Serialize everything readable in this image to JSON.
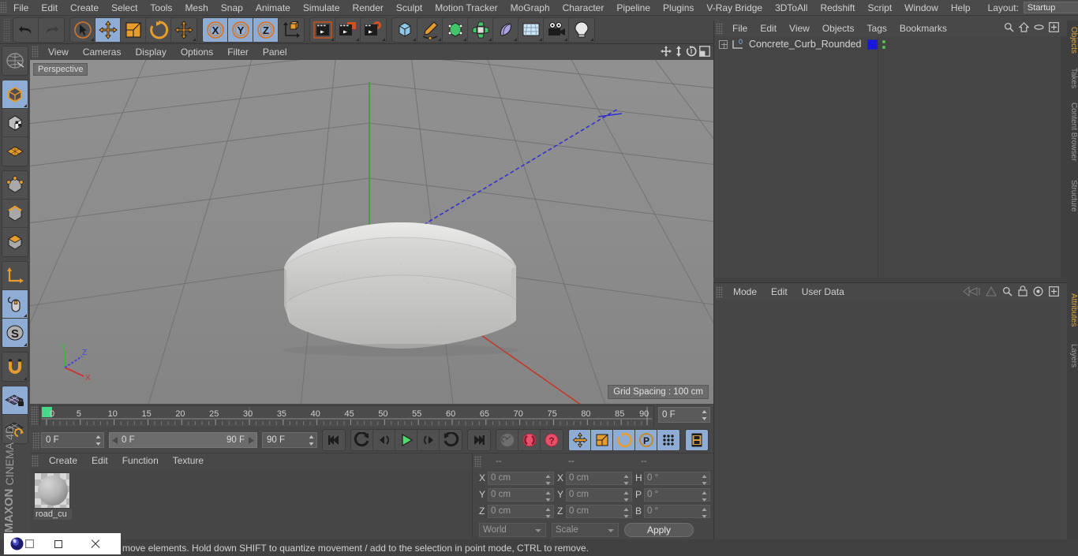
{
  "menubar": {
    "items": [
      "File",
      "Edit",
      "Create",
      "Select",
      "Tools",
      "Mesh",
      "Snap",
      "Animate",
      "Simulate",
      "Render",
      "Sculpt",
      "Motion Tracker",
      "MoGraph",
      "Character",
      "Pipeline",
      "Plugins",
      "V-Ray Bridge",
      "3DToAll",
      "Redshift",
      "Script",
      "Window",
      "Help"
    ],
    "layout_label": "Layout:",
    "layout_value": "Startup"
  },
  "toolbar": {
    "groups": [
      {
        "name": "history",
        "buttons": [
          {
            "icon": "undo-icon",
            "active": false
          },
          {
            "icon": "redo-icon",
            "active": false
          }
        ]
      },
      {
        "name": "transform",
        "buttons": [
          {
            "icon": "live-selection-icon",
            "active": false
          },
          {
            "icon": "move-icon",
            "active": true
          },
          {
            "icon": "scale-icon",
            "active": false
          },
          {
            "icon": "rotate-icon",
            "active": false
          },
          {
            "icon": "dynamic-place-icon",
            "active": false
          }
        ]
      },
      {
        "name": "axis-lock",
        "buttons": [
          {
            "icon": "lock-x-icon",
            "active": true
          },
          {
            "icon": "lock-y-icon",
            "active": true
          },
          {
            "icon": "lock-z-icon",
            "active": true
          },
          {
            "icon": "world-coordinate-icon",
            "active": false
          }
        ]
      },
      {
        "name": "render",
        "buttons": [
          {
            "icon": "render-view-icon",
            "active": false
          },
          {
            "icon": "render-region-icon",
            "active": false
          },
          {
            "icon": "render-settings-icon",
            "active": false
          }
        ]
      },
      {
        "name": "create",
        "buttons": [
          {
            "icon": "cube-primitive-icon",
            "active": false
          },
          {
            "icon": "spline-pen-icon",
            "active": false
          },
          {
            "icon": "generator-icon",
            "active": false
          },
          {
            "icon": "mograph-icon",
            "active": false
          },
          {
            "icon": "deformer-icon",
            "active": false
          },
          {
            "icon": "floor-scene-icon",
            "active": false
          },
          {
            "icon": "camera-icon",
            "active": false
          },
          {
            "icon": "light-icon",
            "active": false
          }
        ]
      }
    ]
  },
  "lefttoolbar": {
    "groups": [
      {
        "buttons": [
          {
            "icon": "make-editable-icon",
            "active": false
          }
        ]
      },
      {
        "buttons": [
          {
            "icon": "model-mode-icon",
            "active": true
          },
          {
            "icon": "texture-mode-icon",
            "active": false
          },
          {
            "icon": "workplane-mode-icon",
            "active": false
          }
        ]
      },
      {
        "buttons": [
          {
            "icon": "point-mode-icon",
            "active": false
          },
          {
            "icon": "edge-mode-icon",
            "active": false
          },
          {
            "icon": "polygon-mode-icon",
            "active": false
          }
        ]
      },
      {
        "buttons": [
          {
            "icon": "axis-modify-icon",
            "active": false
          },
          {
            "icon": "viewport-solo-icon",
            "active": true
          },
          {
            "icon": "enable-snapping-icon",
            "active": true
          }
        ]
      },
      {
        "buttons": [
          {
            "icon": "magnet-icon",
            "active": false
          }
        ]
      },
      {
        "buttons": [
          {
            "icon": "workplane-lock-icon",
            "active": true
          },
          {
            "icon": "workplane-align-icon",
            "active": false
          }
        ]
      }
    ],
    "brand_line1": "MAXON",
    "brand_line2": "CINEMA 4D"
  },
  "viewport": {
    "menu": [
      "View",
      "Cameras",
      "Display",
      "Options",
      "Filter",
      "Panel"
    ],
    "nav_icons": [
      "pan-icon",
      "dolly-icon",
      "rotate-view-icon",
      "maximize-view-icon"
    ],
    "label": "Perspective",
    "grid_spacing": "Grid Spacing : 100 cm",
    "axis_labels": {
      "x": "X",
      "y": "Y",
      "z": "Z"
    },
    "axis_colors": {
      "x": "#cc3333",
      "y": "#33bb33",
      "z": "#3333cc"
    },
    "object_name": "Concrete_Curb_Rounded"
  },
  "timeline": {
    "ticks": [
      "0",
      "5",
      "10",
      "15",
      "20",
      "25",
      "30",
      "35",
      "40",
      "45",
      "50",
      "55",
      "60",
      "65",
      "70",
      "75",
      "80",
      "85",
      "90"
    ],
    "playhead_frame": "0",
    "frame_field": "0 F"
  },
  "playbar": {
    "current_frame": "0 F",
    "range_start": "0 F",
    "range_end": "90 F",
    "end_frame": "90 F",
    "buttons": [
      {
        "icon": "go-to-start-icon",
        "active": false
      },
      {
        "icon": "previous-key-icon",
        "active": false
      },
      {
        "icon": "step-back-icon",
        "active": false
      },
      {
        "icon": "play-icon",
        "active": false
      },
      {
        "icon": "step-forward-icon",
        "active": false
      },
      {
        "icon": "next-key-icon",
        "active": false
      },
      {
        "icon": "go-to-end-icon",
        "active": false
      }
    ],
    "record_buttons": [
      {
        "icon": "autokey-icon",
        "active": false
      },
      {
        "icon": "record-active-objects-icon",
        "active": false
      },
      {
        "icon": "keyframe-selection-icon",
        "active": false
      }
    ],
    "key_toggles": [
      {
        "icon": "key-position-icon",
        "active": true
      },
      {
        "icon": "key-scale-icon",
        "active": true
      },
      {
        "icon": "key-rotation-icon",
        "active": true
      },
      {
        "icon": "key-param-icon",
        "active": true
      },
      {
        "icon": "key-pla-icon",
        "active": true
      }
    ],
    "timeline_toggle": {
      "icon": "timeline-icon",
      "active": true
    }
  },
  "material_manager": {
    "menu": [
      "Create",
      "Edit",
      "Function",
      "Texture"
    ],
    "materials": [
      {
        "name": "road_cu",
        "icon": "material-sphere-icon"
      }
    ]
  },
  "coordinate_manager": {
    "headers": [
      "--",
      "--",
      "--"
    ],
    "position": {
      "label_x": "X",
      "label_y": "Y",
      "label_z": "Z",
      "x": "0 cm",
      "y": "0 cm",
      "z": "0 cm"
    },
    "size": {
      "label_x": "X",
      "label_y": "Y",
      "label_z": "Z",
      "x": "0 cm",
      "y": "0 cm",
      "z": "0 cm"
    },
    "rotation": {
      "label_h": "H",
      "label_p": "P",
      "label_b": "B",
      "h": "0 °",
      "p": "0 °",
      "b": "0 °"
    },
    "system": "World",
    "mode": "Scale",
    "apply_label": "Apply"
  },
  "object_manager": {
    "menu": [
      "File",
      "Edit",
      "View",
      "Objects",
      "Tags",
      "Bookmarks"
    ],
    "icons": [
      "search-icon",
      "home-icon",
      "ellipse-icon",
      "expand-icon"
    ],
    "objects": [
      {
        "name": "Concrete_Curb_Rounded",
        "tag_color": "#1818dd",
        "layer": "0"
      }
    ]
  },
  "attribute_manager": {
    "menu": [
      "Mode",
      "Edit",
      "User Data"
    ],
    "icons": [
      "history-back-icon",
      "history-forward-icon",
      "search-icon",
      "lock-icon",
      "target-icon",
      "expand-icon"
    ]
  },
  "dock_tabs": [
    {
      "label": "Objects",
      "color": "#e0a33c"
    },
    {
      "label": "Takes",
      "color": "#9a9a9a"
    },
    {
      "label": "Content Browser",
      "color": "#9a9a9a"
    },
    {
      "label": "Structure",
      "color": "#9a9a9a"
    },
    {
      "label": "Attributes",
      "color": "#e0a33c"
    },
    {
      "label": "Layers",
      "color": "#9a9a9a"
    }
  ],
  "statusbar": {
    "text": "move elements. Hold down SHIFT to quantize movement / add to the selection in point mode, CTRL to remove."
  },
  "window_controls": {
    "app_icon": "c4d-logo-icon",
    "restore": "restore-icon",
    "close": "close-icon"
  }
}
